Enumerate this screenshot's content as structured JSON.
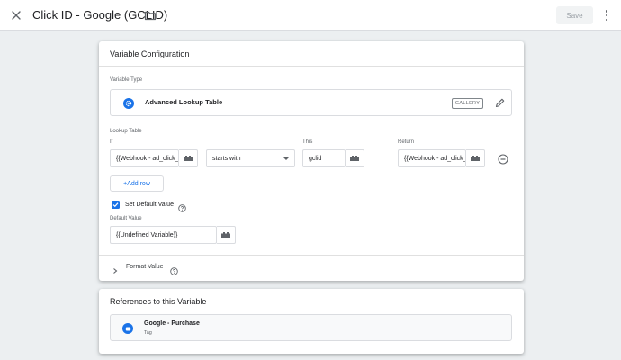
{
  "header": {
    "title": "Click ID - Google (GCLID)",
    "save_label": "Save",
    "close_icon": "close-icon",
    "folder_icon": "folder-icon",
    "more_icon": "more-vert-icon"
  },
  "config": {
    "title": "Variable Configuration",
    "variable_type_label": "Variable Type",
    "variable_type_name": "Advanced Lookup Table",
    "gallery_label": "GALLERY",
    "lookup_table_label": "Lookup Table",
    "columns": {
      "if": "If",
      "this": "This",
      "return": "Return"
    },
    "row": {
      "if_value": "{{Webhook - ad_click_id}}",
      "operator": "starts with",
      "this_value": "gclid",
      "return_value": "{{Webhook - ad_click_id}}"
    },
    "add_row_label": "+Add row",
    "set_default_label": "Set Default Value",
    "set_default_checked": true,
    "default_value_label": "Default Value",
    "default_value": "{{Undefined Variable}}",
    "format_value_label": "Format Value"
  },
  "references": {
    "title": "References to this Variable",
    "items": [
      {
        "name": "Google - Purchase",
        "type": "Tag"
      }
    ]
  },
  "colors": {
    "accent": "#1a73e8",
    "background": "#eceff1",
    "card": "#ffffff"
  }
}
